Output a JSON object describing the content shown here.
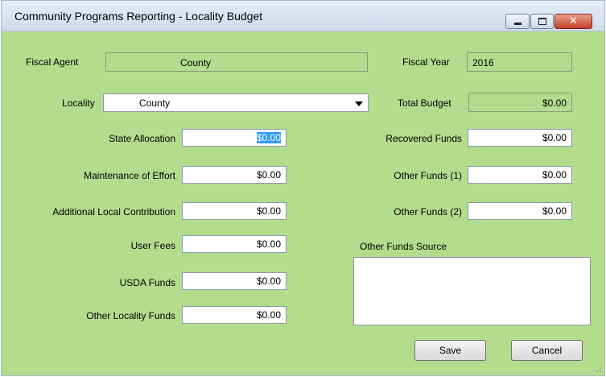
{
  "window": {
    "title": "Community Programs Reporting - Locality Budget",
    "close_glyph": "✕"
  },
  "form": {
    "fiscal_agent_label": "Fiscal Agent",
    "fiscal_agent_value": "County",
    "fiscal_year_label": "Fiscal Year",
    "fiscal_year_value": "2016",
    "locality_label": "Locality",
    "locality_value": "County",
    "total_budget_label": "Total Budget",
    "total_budget_value": "$0.00",
    "state_allocation_label": "State Allocation",
    "state_allocation_value": "$0.00",
    "maintenance_label": "Maintenance of Effort",
    "maintenance_value": "$0.00",
    "additional_local_label": "Additional Local Contribution",
    "additional_local_value": "$0.00",
    "user_fees_label": "User Fees",
    "user_fees_value": "$0.00",
    "usda_label": "USDA Funds",
    "usda_value": "$0.00",
    "other_locality_label": "Other Locality Funds",
    "other_locality_value": "$0.00",
    "recovered_label": "Recovered Funds",
    "recovered_value": "$0.00",
    "other1_label": "Other Funds (1)",
    "other1_value": "$0.00",
    "other2_label": "Other Funds (2)",
    "other2_value": "$0.00",
    "other_source_label": "Other Funds Source",
    "other_source_value": ""
  },
  "buttons": {
    "save": "Save",
    "cancel": "Cancel"
  },
  "colors": {
    "window_background": "#b3dc8d",
    "selection": "#3399ff"
  }
}
